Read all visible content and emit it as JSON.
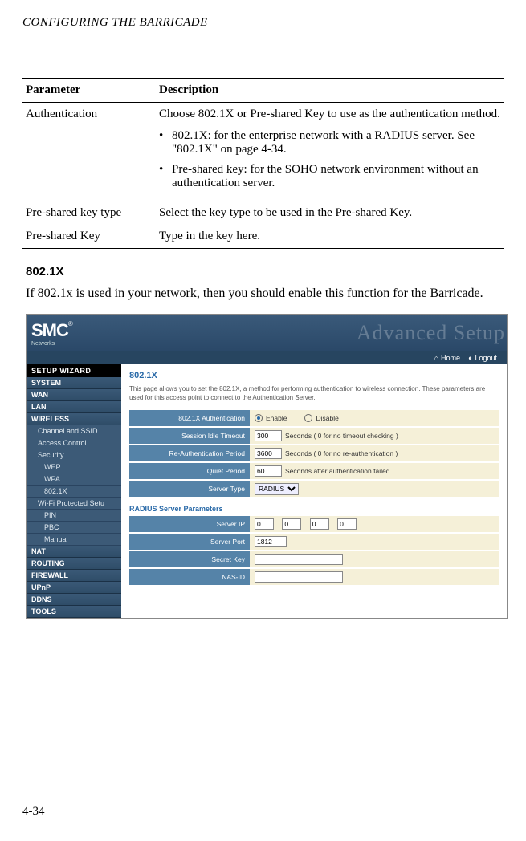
{
  "page_header": "CONFIGURING THE BARRICADE",
  "table": {
    "headers": [
      "Parameter",
      "Description"
    ],
    "rows": [
      {
        "param": "Authentication",
        "desc": "Choose 802.1X or Pre-shared Key to use as the authentication method.",
        "bullets": [
          "802.1X: for the enterprise network with a RADIUS server. See \"802.1X\" on page 4-34.",
          "Pre-shared key: for the SOHO network environment without an authentication server."
        ]
      },
      {
        "param": "Pre-shared key type",
        "desc": "Select the key type to be used in the Pre-shared Key."
      },
      {
        "param": "Pre-shared Key",
        "desc": "Type in the key here."
      }
    ]
  },
  "section_title": "802.1X",
  "section_text": "If 802.1x is used in your network, then you should enable this function for the Barricade.",
  "shot": {
    "logo_text": "SMC",
    "logo_sub": "Networks",
    "adv_text": "Advanced Setup",
    "toolbar": {
      "home": "Home",
      "logout": "Logout"
    },
    "sidebar": {
      "setup": "SETUP WIZARD",
      "items": [
        "SYSTEM",
        "WAN",
        "LAN",
        "WIRELESS"
      ],
      "wireless_sub": [
        "Channel and SSID",
        "Access Control",
        "Security"
      ],
      "security_sub": [
        "WEP",
        "WPA",
        "802.1X"
      ],
      "wifi_protect": "Wi-Fi Protected Setu",
      "wifi_sub": [
        "PIN",
        "PBC",
        "Manual"
      ],
      "items2": [
        "NAT",
        "ROUTING",
        "FIREWALL",
        "UPnP",
        "DDNS",
        "TOOLS"
      ]
    },
    "content": {
      "title": "802.1X",
      "intro": "This page allows you to set the 802.1X, a method for performing authentication to wireless connection. These parameters are used for this access point to connect to the Authentication Server.",
      "rows": [
        {
          "label": "802.1X Authentication",
          "enable": "Enable",
          "disable": "Disable"
        },
        {
          "label": "Session Idle Timeout",
          "value": "300",
          "suffix": "Seconds ( 0 for no timeout checking )"
        },
        {
          "label": "Re-Authentication Period",
          "value": "3600",
          "suffix": "Seconds ( 0 for no re-authentication )"
        },
        {
          "label": "Quiet Period",
          "value": "60",
          "suffix": "Seconds after authentication failed"
        },
        {
          "label": "Server Type",
          "select": "RADIUS"
        }
      ],
      "subhead": "RADIUS Server Parameters",
      "rows2": [
        {
          "label": "Server IP",
          "ip": [
            "0",
            "0",
            "0",
            "0"
          ]
        },
        {
          "label": "Server Port",
          "value": "1812"
        },
        {
          "label": "Secret Key",
          "value": ""
        },
        {
          "label": "NAS-ID",
          "value": ""
        }
      ]
    }
  },
  "page_number": "4-34"
}
